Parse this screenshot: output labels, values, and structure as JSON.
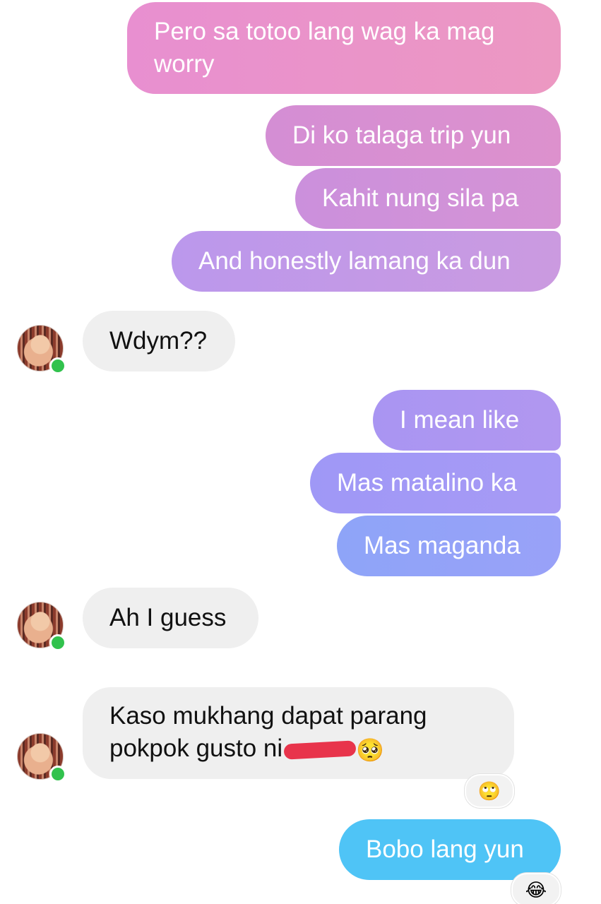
{
  "conversation": {
    "messages": [
      {
        "side": "sent",
        "text": "Pero sa totoo lang wag ka mag worry",
        "color": "#e893c8"
      },
      {
        "side": "sent",
        "text": "Di ko talaga trip yun",
        "color": "#d58fd2"
      },
      {
        "side": "sent",
        "text": "Kahit nung sila pa",
        "color": "#cf8fd6"
      },
      {
        "side": "sent",
        "text": "And honestly lamang ka dun",
        "color": "#c49bea"
      },
      {
        "side": "received",
        "text": "Wdym??",
        "color": "#efefef"
      },
      {
        "side": "sent",
        "text": "I mean like",
        "color": "#ac98f3"
      },
      {
        "side": "sent",
        "text": "Mas matalino ka",
        "color": "#a39cf6"
      },
      {
        "side": "sent",
        "text": "Mas maganda",
        "color": "#96a2f8"
      },
      {
        "side": "received",
        "text": "Ah I guess",
        "color": "#efefef"
      },
      {
        "side": "received",
        "text": "Kaso mukhang dapat parang pokpok gusto ni",
        "trailing_emoji": "🥺",
        "reaction": "🙄",
        "color": "#efefef"
      },
      {
        "side": "sent",
        "text": "Bobo lang yun",
        "reaction": "😂",
        "color": "#4fc4f6"
      }
    ]
  },
  "avatar_icon": "user-avatar-icon",
  "online_indicator_color": "#31c24d"
}
